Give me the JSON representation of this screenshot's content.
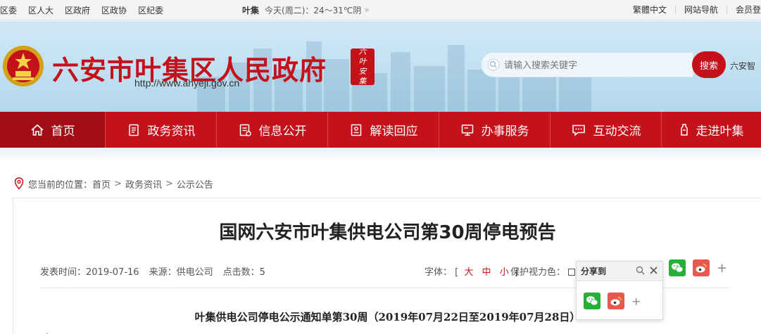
{
  "topbar": {
    "links": [
      "区委",
      "区人大",
      "区政府",
      "区政协",
      "区纪委"
    ],
    "weather": {
      "city": "叶集",
      "text": "今天(周二)：24～31℃阴",
      "more": "»"
    },
    "right_links": [
      "繁體中文",
      "网站导航",
      "会员登"
    ]
  },
  "header": {
    "site_title": "六安市叶集区人民政府",
    "site_url": "http://www.ahyeji.gov.cn",
    "seal_text": [
      "六",
      "叶",
      "安",
      "集"
    ],
    "search": {
      "placeholder": "请输入搜索关键字",
      "button": "搜索",
      "side_text": "六安智"
    }
  },
  "nav": {
    "items": [
      {
        "label": "首页",
        "icon": "home-icon"
      },
      {
        "label": "政务资讯",
        "icon": "document-icon"
      },
      {
        "label": "信息公开",
        "icon": "list-icon"
      },
      {
        "label": "解读回应",
        "icon": "reading-icon"
      },
      {
        "label": "办事服务",
        "icon": "monitor-icon"
      },
      {
        "label": "互动交流",
        "icon": "chat-icon"
      },
      {
        "label": "走进叶集",
        "icon": "figure-icon"
      }
    ]
  },
  "breadcrumb": {
    "prefix": "您当前的位置：",
    "items": [
      "首页",
      "政务资讯",
      "公示公告"
    ],
    "sep": ">"
  },
  "article": {
    "title": "国网六安市叶集供电公司第30周停电预告",
    "publish_time": "发表时间：2019-07-16",
    "source": "来源：供电公司",
    "clicks": "点击数：5",
    "font_label": "字体：",
    "font_open": "[",
    "font_sizes": [
      "大",
      "中",
      "小"
    ],
    "font_close": "]",
    "protect_label": "保护视力色：",
    "subheading": "叶集供电公司停电公示通知单第30周（2019年07月22日至2019年07月28日）",
    "body_start": "序"
  },
  "share": {
    "title": "分享到",
    "plus": "+"
  },
  "colors": {
    "brand_red": "#c4111a",
    "wechat_green": "#2aae3a",
    "weibo_red": "#e8584e"
  }
}
